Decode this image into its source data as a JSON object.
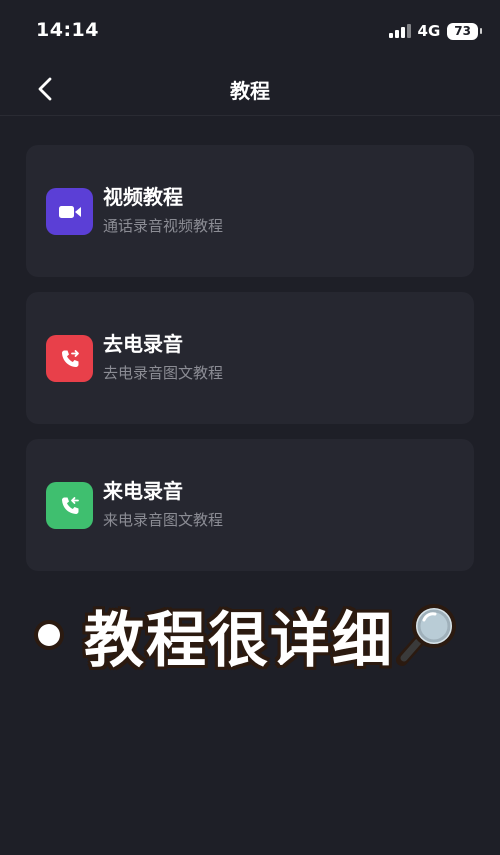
{
  "status_bar": {
    "time": "14:14",
    "network": "4G",
    "battery": "73"
  },
  "nav": {
    "title": "教程"
  },
  "items": [
    {
      "title": "视频教程",
      "subtitle": "通话录音视频教程",
      "icon": "video-camera-icon",
      "color": "#5b3fd6"
    },
    {
      "title": "去电录音",
      "subtitle": "去电录音图文教程",
      "icon": "outgoing-call-icon",
      "color": "#e8404a"
    },
    {
      "title": "来电录音",
      "subtitle": "来电录音图文教程",
      "icon": "incoming-call-icon",
      "color": "#3fbf6f"
    }
  ],
  "caption": {
    "text": "教程很详细",
    "icon": "magnifying-glass-icon"
  }
}
